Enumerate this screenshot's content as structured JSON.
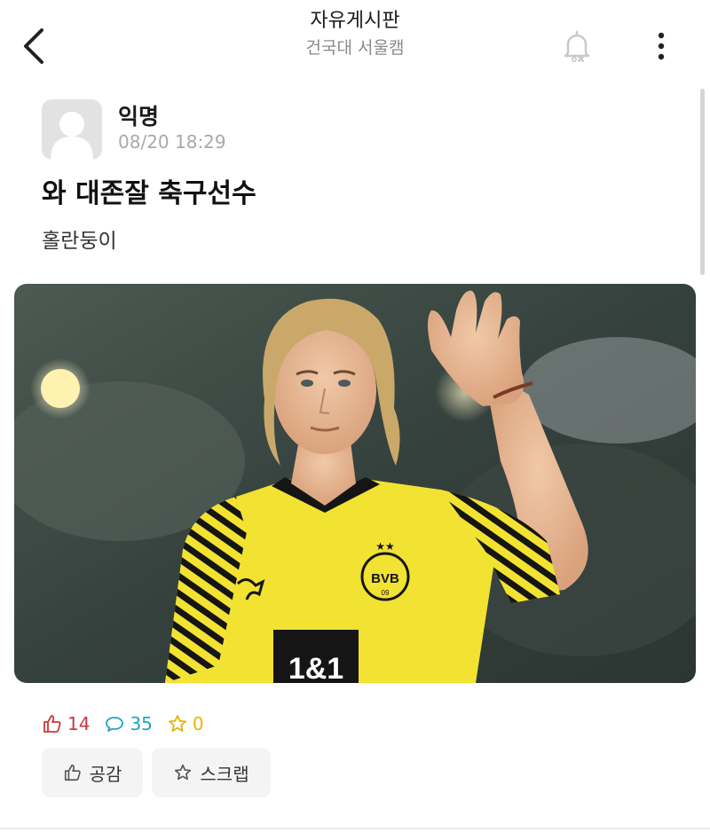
{
  "header": {
    "title": "자유게시판",
    "subtitle": "건국대 서울캠"
  },
  "post": {
    "author": "익명",
    "time": "08/20 18:29",
    "title": "와 대존잘 축구선수",
    "body": "홀란둥이"
  },
  "photo": {
    "jersey_sponsor": "1&1",
    "badge": "BVB",
    "badge_year": "09"
  },
  "stats": {
    "likes": "14",
    "comments": "35",
    "scraps": "0"
  },
  "actions": {
    "like_label": "공감",
    "scrap_label": "스크랩"
  },
  "colors": {
    "like": "#c9373b",
    "comment": "#1ea4c2",
    "scrap": "#e8b400",
    "jersey": "#f2e232"
  }
}
